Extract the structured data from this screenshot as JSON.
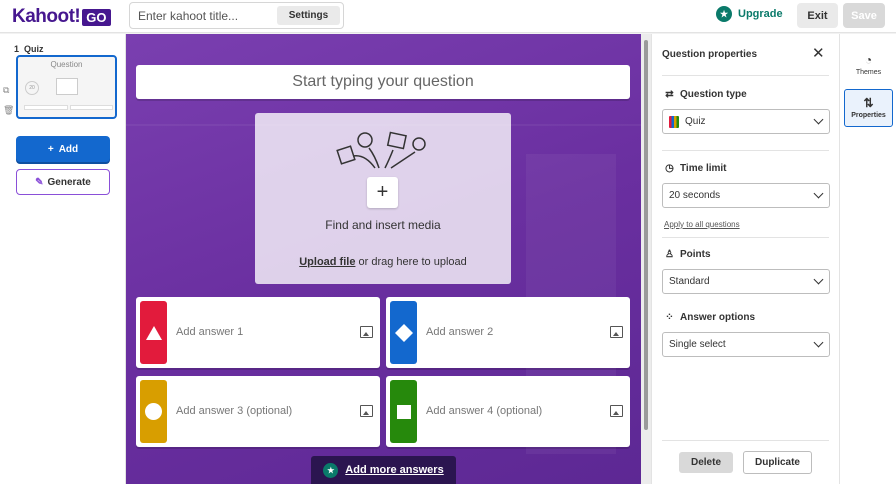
{
  "header": {
    "logo_text": "Kahoot!",
    "logo_badge": "GO",
    "title_placeholder": "Enter kahoot title...",
    "settings_label": "Settings",
    "upgrade_label": "Upgrade",
    "exit_label": "Exit",
    "save_label": "Save"
  },
  "sidebar": {
    "slide_number": "1",
    "slide_type": "Quiz",
    "thumb_title": "Question",
    "thumb_timer": "20",
    "add_label": "Add",
    "generate_label": "Generate"
  },
  "editor": {
    "question_placeholder": "Start typing your question",
    "media_prompt": "Find and insert media",
    "upload_link": "Upload file",
    "upload_hint": "or drag here to upload",
    "answers": [
      {
        "label": "Add answer 1",
        "color": "#e21b3c",
        "shape": "triangle"
      },
      {
        "label": "Add answer 2",
        "color": "#1368ce",
        "shape": "diamond"
      },
      {
        "label": "Add answer 3 (optional)",
        "color": "#d89e00",
        "shape": "circle"
      },
      {
        "label": "Add answer 4 (optional)",
        "color": "#26890c",
        "shape": "square"
      }
    ],
    "more_answers_label": "Add more answers"
  },
  "properties": {
    "title": "Question properties",
    "question_type_label": "Question type",
    "question_type_value": "Quiz",
    "time_limit_label": "Time limit",
    "time_limit_value": "20 seconds",
    "apply_all_label": "Apply to all questions",
    "points_label": "Points",
    "points_value": "Standard",
    "answer_options_label": "Answer options",
    "answer_options_value": "Single select",
    "delete_label": "Delete",
    "duplicate_label": "Duplicate"
  },
  "rail": {
    "themes_label": "Themes",
    "properties_label": "Properties"
  },
  "colors": {
    "brand_purple": "#46178f",
    "primary_blue": "#1368ce",
    "upgrade_teal": "#0a7a6a"
  }
}
